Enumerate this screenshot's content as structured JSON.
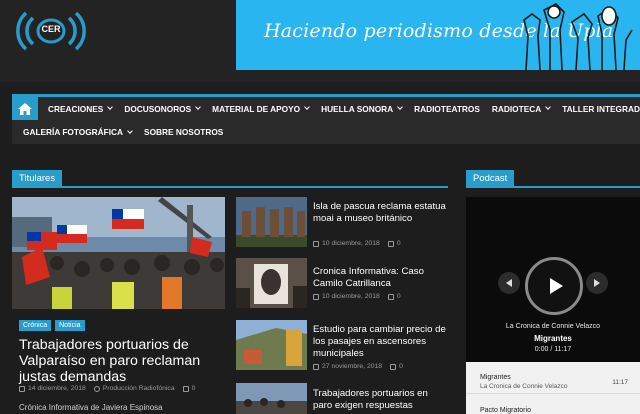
{
  "header": {
    "logo_text": "CER",
    "banner_text": "Haciendo periodismo desde la Upla"
  },
  "nav": {
    "items": [
      {
        "label": "CREACIONES",
        "dropdown": true
      },
      {
        "label": "DOCUSONOROS",
        "dropdown": true
      },
      {
        "label": "MATERIAL DE APOYO",
        "dropdown": true
      },
      {
        "label": "HUELLA SONORA",
        "dropdown": true
      },
      {
        "label": "RADIOTEATROS",
        "dropdown": false
      },
      {
        "label": "RADIOTECA",
        "dropdown": true
      },
      {
        "label": "TALLER INTEGRADO",
        "dropdown": true
      }
    ],
    "row2": [
      {
        "label": "GALERÍA FOTOGRÁFICA",
        "dropdown": true
      },
      {
        "label": "SOBRE NOSOTROS",
        "dropdown": false
      }
    ]
  },
  "titulares": {
    "label": "Titulares",
    "feature": {
      "tags": [
        "Crónica",
        "Noticia"
      ],
      "title": "Trabajadores portuarios de Valparaíso en paro reclaman justas demandas",
      "date": "14 diciembre, 2018",
      "author": "Producción Radiofónica",
      "comments": "0",
      "excerpt": "Crónica Informativa de Javiera Espinosa"
    },
    "items": [
      {
        "title": "Isla de pascua reclama estatua moai a museo británico",
        "date": "10 diciembre, 2018",
        "comments": "0"
      },
      {
        "title": "Cronica Informativa: Caso Camilo Catrillanca",
        "date": "10 diciembre, 2018",
        "comments": "0"
      },
      {
        "title": "Estudio para cambiar precio de los pasajes en ascensores municipales",
        "date": "27 noviembre, 2018",
        "comments": "0"
      },
      {
        "title": "Trabajadores portuarios en paro exigen respuestas",
        "date": "",
        "comments": ""
      }
    ]
  },
  "podcast": {
    "label": "Podcast",
    "author": "La Cronica de Connie Velazco",
    "track": "Migrantes",
    "time": "0:00 / 11:17",
    "playlist": [
      {
        "title": "Migrantes",
        "subtitle": "La Cronica de Connie Velazco",
        "duration": "11:17"
      },
      {
        "title": "Pacto Migratorio",
        "subtitle": "",
        "duration": ""
      }
    ]
  },
  "colors": {
    "accent": "#289dcc",
    "background": "#1d1d1d",
    "banner": "#29b6f0"
  }
}
